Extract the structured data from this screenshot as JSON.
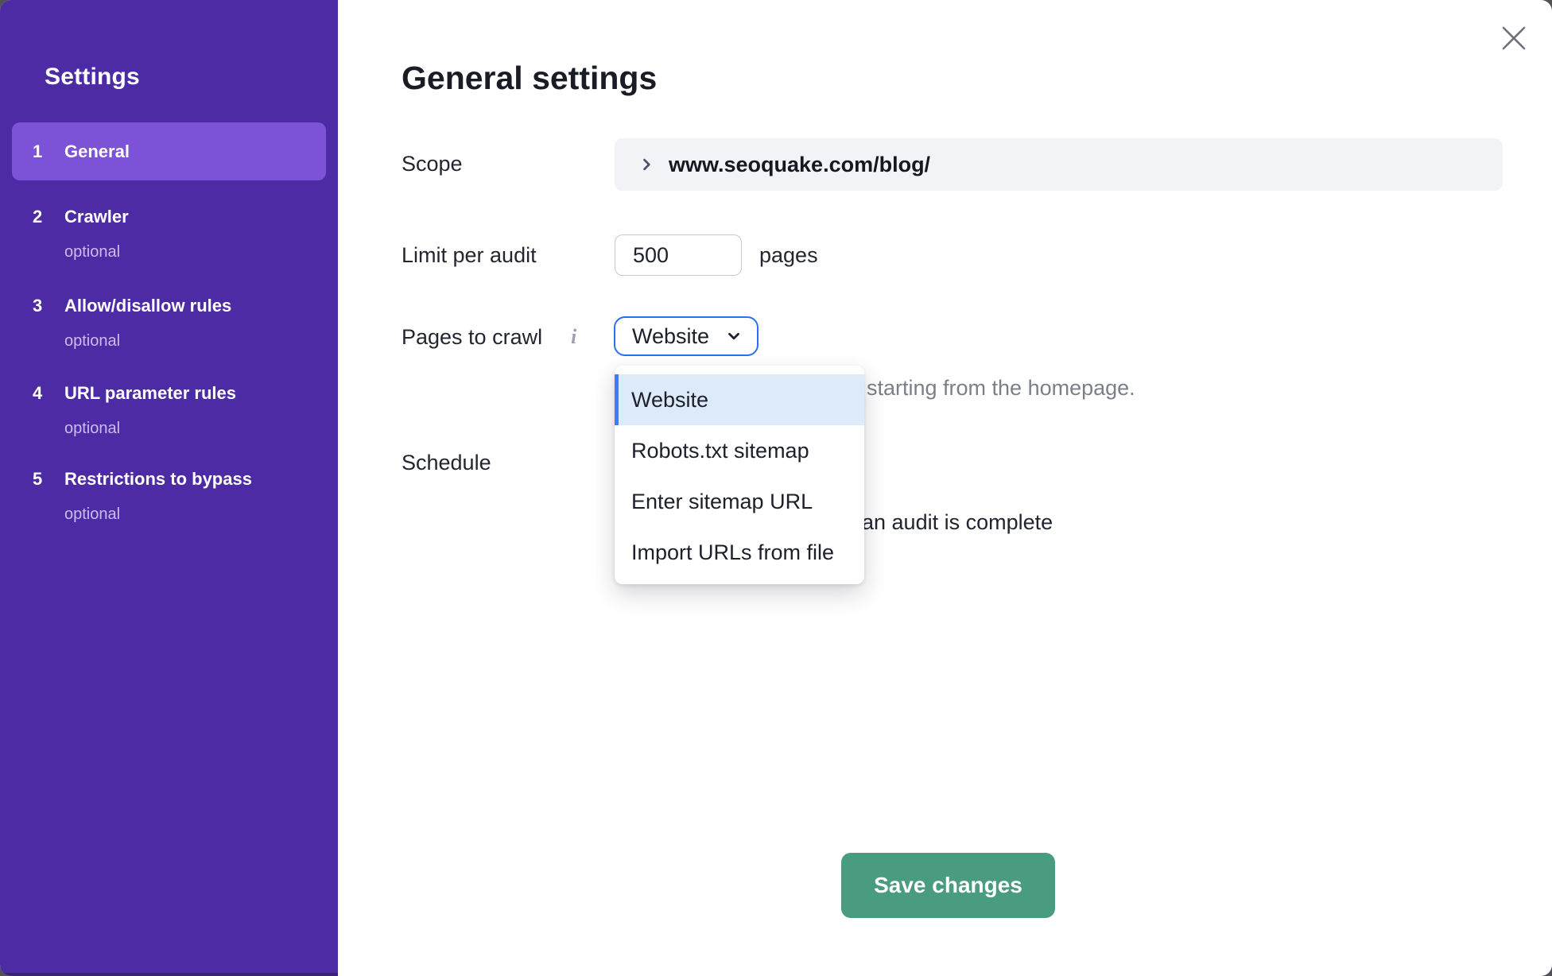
{
  "sidebar": {
    "title": "Settings",
    "items": [
      {
        "number": "1",
        "label": "General",
        "optional": ""
      },
      {
        "number": "2",
        "label": "Crawler",
        "optional": "optional"
      },
      {
        "number": "3",
        "label": "Allow/disallow rules",
        "optional": "optional"
      },
      {
        "number": "4",
        "label": "URL parameter rules",
        "optional": "optional"
      },
      {
        "number": "5",
        "label": "Restrictions to bypass",
        "optional": "optional"
      }
    ]
  },
  "header": {
    "title": "General settings"
  },
  "form": {
    "scope_label": "Scope",
    "scope_value": "www.seoquake.com/blog/",
    "limit_label": "Limit per audit",
    "limit_value": "500",
    "limit_unit": "pages",
    "pages_label": "Pages to crawl",
    "pages_selected": "Website",
    "pages_options": [
      "Website",
      "Robots.txt sitemap",
      "Enter sitemap URL",
      "Import URLs from file"
    ],
    "pages_helper_visible": "starting from the homepage.",
    "schedule_label": "Schedule",
    "schedule_visible_text": "an audit is complete"
  },
  "footer": {
    "save_label": "Save changes"
  },
  "colors": {
    "sidebar_bg": "#4C2BA4",
    "sidebar_active_bg": "#7C52D6",
    "accent_blue": "#2B6FF2",
    "option_selected_bg": "#DCEAFA",
    "save_green": "#4A9C80",
    "field_bg": "#F2F3F7",
    "helper_gray": "#7A7F89"
  }
}
